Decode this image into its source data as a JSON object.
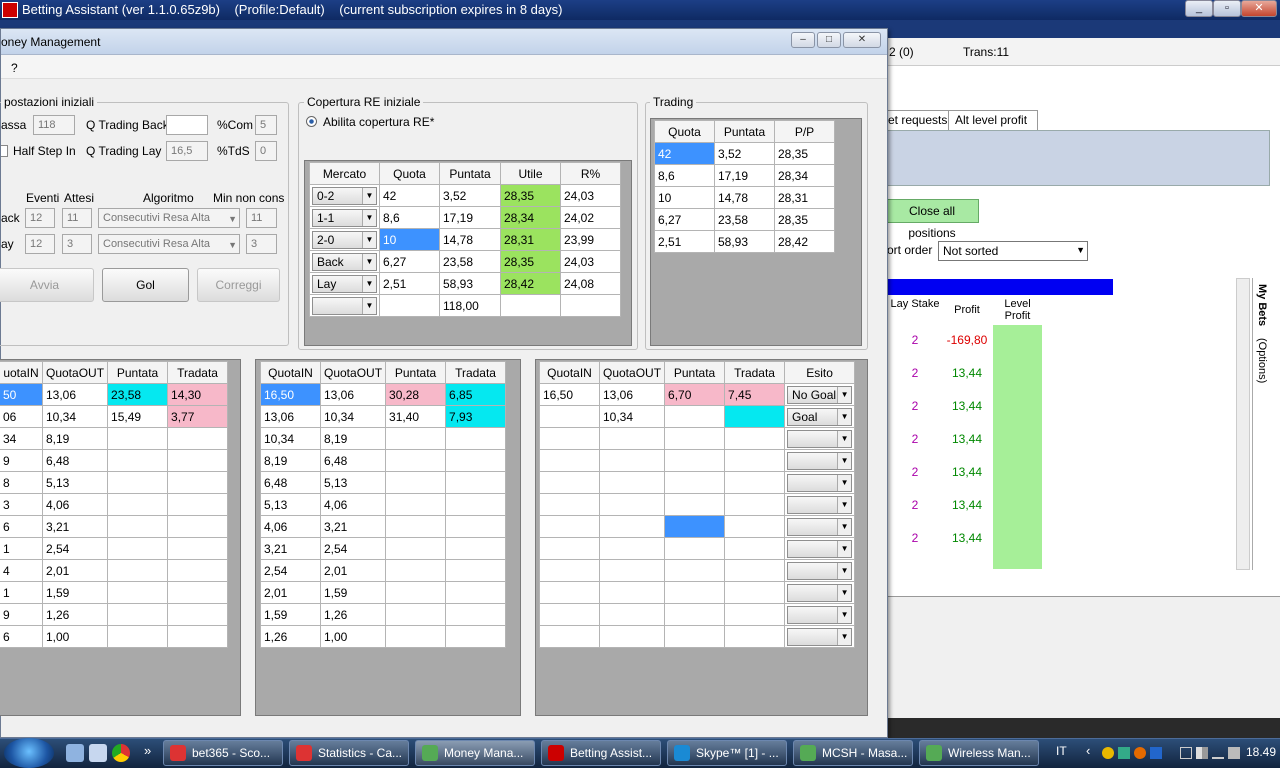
{
  "window": {
    "title": "Betting Assistant (ver 1.1.0.65z9b)    (Profile:Default)    (current subscription expires in 8 days)"
  },
  "bg": {
    "header_frag": "2 (0)",
    "trans": "Trans:11",
    "tabs": [
      "et requests",
      "Alt level profit"
    ],
    "close_all": "Close all positions",
    "sort_label": "ort order",
    "sort_value": "Not sorted",
    "col_lay_stake": "Lay Stake",
    "col_profit": "Profit",
    "col_level_profit": "Level Profit",
    "mybets": "My Bets",
    "options": "(Options)",
    "bets": [
      {
        "stake": "2",
        "profit": "-169,80"
      },
      {
        "stake": "2",
        "profit": "13,44"
      },
      {
        "stake": "2",
        "profit": "13,44"
      },
      {
        "stake": "2",
        "profit": "13,44"
      },
      {
        "stake": "2",
        "profit": "13,44"
      },
      {
        "stake": "2",
        "profit": "13,44"
      },
      {
        "stake": "2",
        "profit": "13,44"
      }
    ]
  },
  "mm": {
    "title": "oney Management",
    "menu": "?",
    "imp": {
      "title": "postazioni iniziali",
      "cassa_label": "assa",
      "cassa_value": "118",
      "qtb_label": "Q Trading Back",
      "qtb_value": "",
      "com_label": "%Com",
      "com_value": "5",
      "half_step": "Half Step In",
      "qtl_label": "Q Trading Lay",
      "qtl_value": "16,5",
      "tds_label": "%TdS",
      "tds_value": "0",
      "col_eventi": "Eventi",
      "col_attesi": "Attesi",
      "col_algoritmo": "Algoritmo",
      "col_min": "Min non cons",
      "back_label": "ack",
      "back_eventi": "12",
      "back_attesi": "11",
      "back_alg": "Consecutivi Resa Alta",
      "back_min": "11",
      "lay_label": "ay",
      "lay_eventi": "12",
      "lay_attesi": "3",
      "lay_alg": "Consecutivi Resa Alta",
      "lay_min": "3",
      "avvia": "Avvia",
      "gol": "Gol",
      "correggi": "Correggi"
    },
    "cop": {
      "title": "Copertura RE iniziale",
      "radio": "Abilita copertura RE*",
      "headers": [
        "Mercato",
        "Quota",
        "Puntata",
        "Utile",
        "R%"
      ],
      "rows": [
        [
          "0-2",
          "42",
          "3,52",
          "28,35",
          "24,03"
        ],
        [
          "1-1",
          "8,6",
          "17,19",
          "28,34",
          "24,02"
        ],
        [
          "2-0",
          "10",
          "14,78",
          "28,31",
          "23,99"
        ],
        [
          "Back",
          "6,27",
          "23,58",
          "28,35",
          "24,03"
        ],
        [
          "Lay",
          "2,51",
          "58,93",
          "28,42",
          "24,08"
        ],
        [
          "",
          "",
          "118,00",
          "",
          ""
        ]
      ]
    },
    "trading": {
      "title": "Trading",
      "headers": [
        "Quota",
        "Puntata",
        "P/P"
      ],
      "rows": [
        [
          "42",
          "3,52",
          "28,35"
        ],
        [
          "8,6",
          "17,19",
          "28,34"
        ],
        [
          "10",
          "14,78",
          "28,31"
        ],
        [
          "6,27",
          "23,58",
          "28,35"
        ],
        [
          "2,51",
          "58,93",
          "28,42"
        ]
      ]
    },
    "t1": {
      "headers": [
        "uotaIN",
        "QuotaOUT",
        "Puntata",
        "Tradata"
      ],
      "rows": [
        [
          "50",
          "13,06",
          "23,58",
          "14,30"
        ],
        [
          "06",
          "10,34",
          "15,49",
          "3,77"
        ],
        [
          "34",
          "8,19",
          "",
          ""
        ],
        [
          "9",
          "6,48",
          "",
          ""
        ],
        [
          "8",
          "5,13",
          "",
          ""
        ],
        [
          "3",
          "4,06",
          "",
          ""
        ],
        [
          "6",
          "3,21",
          "",
          ""
        ],
        [
          "1",
          "2,54",
          "",
          ""
        ],
        [
          "4",
          "2,01",
          "",
          ""
        ],
        [
          "1",
          "1,59",
          "",
          ""
        ],
        [
          "9",
          "1,26",
          "",
          ""
        ],
        [
          "6",
          "1,00",
          "",
          ""
        ]
      ]
    },
    "t2": {
      "headers": [
        "QuotaIN",
        "QuotaOUT",
        "Puntata",
        "Tradata"
      ],
      "rows": [
        [
          "16,50",
          "13,06",
          "30,28",
          "6,85"
        ],
        [
          "13,06",
          "10,34",
          "31,40",
          "7,93"
        ],
        [
          "10,34",
          "8,19",
          "",
          ""
        ],
        [
          "8,19",
          "6,48",
          "",
          ""
        ],
        [
          "6,48",
          "5,13",
          "",
          ""
        ],
        [
          "5,13",
          "4,06",
          "",
          ""
        ],
        [
          "4,06",
          "3,21",
          "",
          ""
        ],
        [
          "3,21",
          "2,54",
          "",
          ""
        ],
        [
          "2,54",
          "2,01",
          "",
          ""
        ],
        [
          "2,01",
          "1,59",
          "",
          ""
        ],
        [
          "1,59",
          "1,26",
          "",
          ""
        ],
        [
          "1,26",
          "1,00",
          "",
          ""
        ]
      ]
    },
    "t3": {
      "headers": [
        "QuotaIN",
        "QuotaOUT",
        "Puntata",
        "Tradata",
        "Esito"
      ],
      "rows": [
        [
          "16,50",
          "13,06",
          "6,70",
          "7,45",
          "No Goal"
        ],
        [
          "",
          "10,34",
          "",
          "",
          "Goal"
        ],
        [
          "",
          "",
          "",
          "",
          ""
        ],
        [
          "",
          "",
          "",
          "",
          ""
        ],
        [
          "",
          "",
          "",
          "",
          ""
        ],
        [
          "",
          "",
          "",
          "",
          ""
        ],
        [
          "",
          "",
          "",
          "",
          ""
        ],
        [
          "",
          "",
          "",
          "",
          ""
        ],
        [
          "",
          "",
          "",
          "",
          ""
        ],
        [
          "",
          "",
          "",
          "",
          ""
        ],
        [
          "",
          "",
          "",
          "",
          ""
        ],
        [
          "",
          "",
          "",
          "",
          ""
        ]
      ]
    }
  },
  "taskbar": {
    "items": [
      "bet365 - Sco...",
      "Statistics - Ca...",
      "Money Mana...",
      "Betting Assist...",
      "Skype™ [1] - ...",
      "MCSH - Masa...",
      "Wireless Man..."
    ],
    "lang": "IT",
    "clock": "18.49"
  }
}
